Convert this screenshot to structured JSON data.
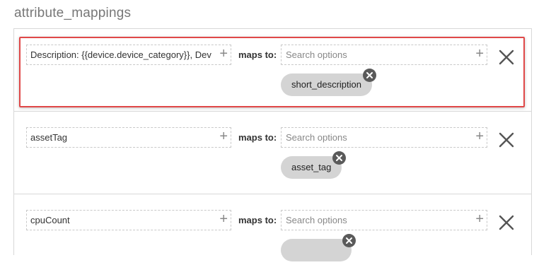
{
  "section_title": "attribute_mappings",
  "maps_to_label": "maps to:",
  "search_placeholder": "Search options",
  "rows": [
    {
      "source": "Description: {{device.device_category}}, Dev",
      "target": "short_description"
    },
    {
      "source": "assetTag",
      "target": "asset_tag"
    },
    {
      "source": "cpuCount",
      "target": ""
    }
  ],
  "highlight_color": "#e04848",
  "icons": {
    "add": "plus-icon",
    "remove": "close-x-icon",
    "chip_remove": "circle-x-icon"
  }
}
